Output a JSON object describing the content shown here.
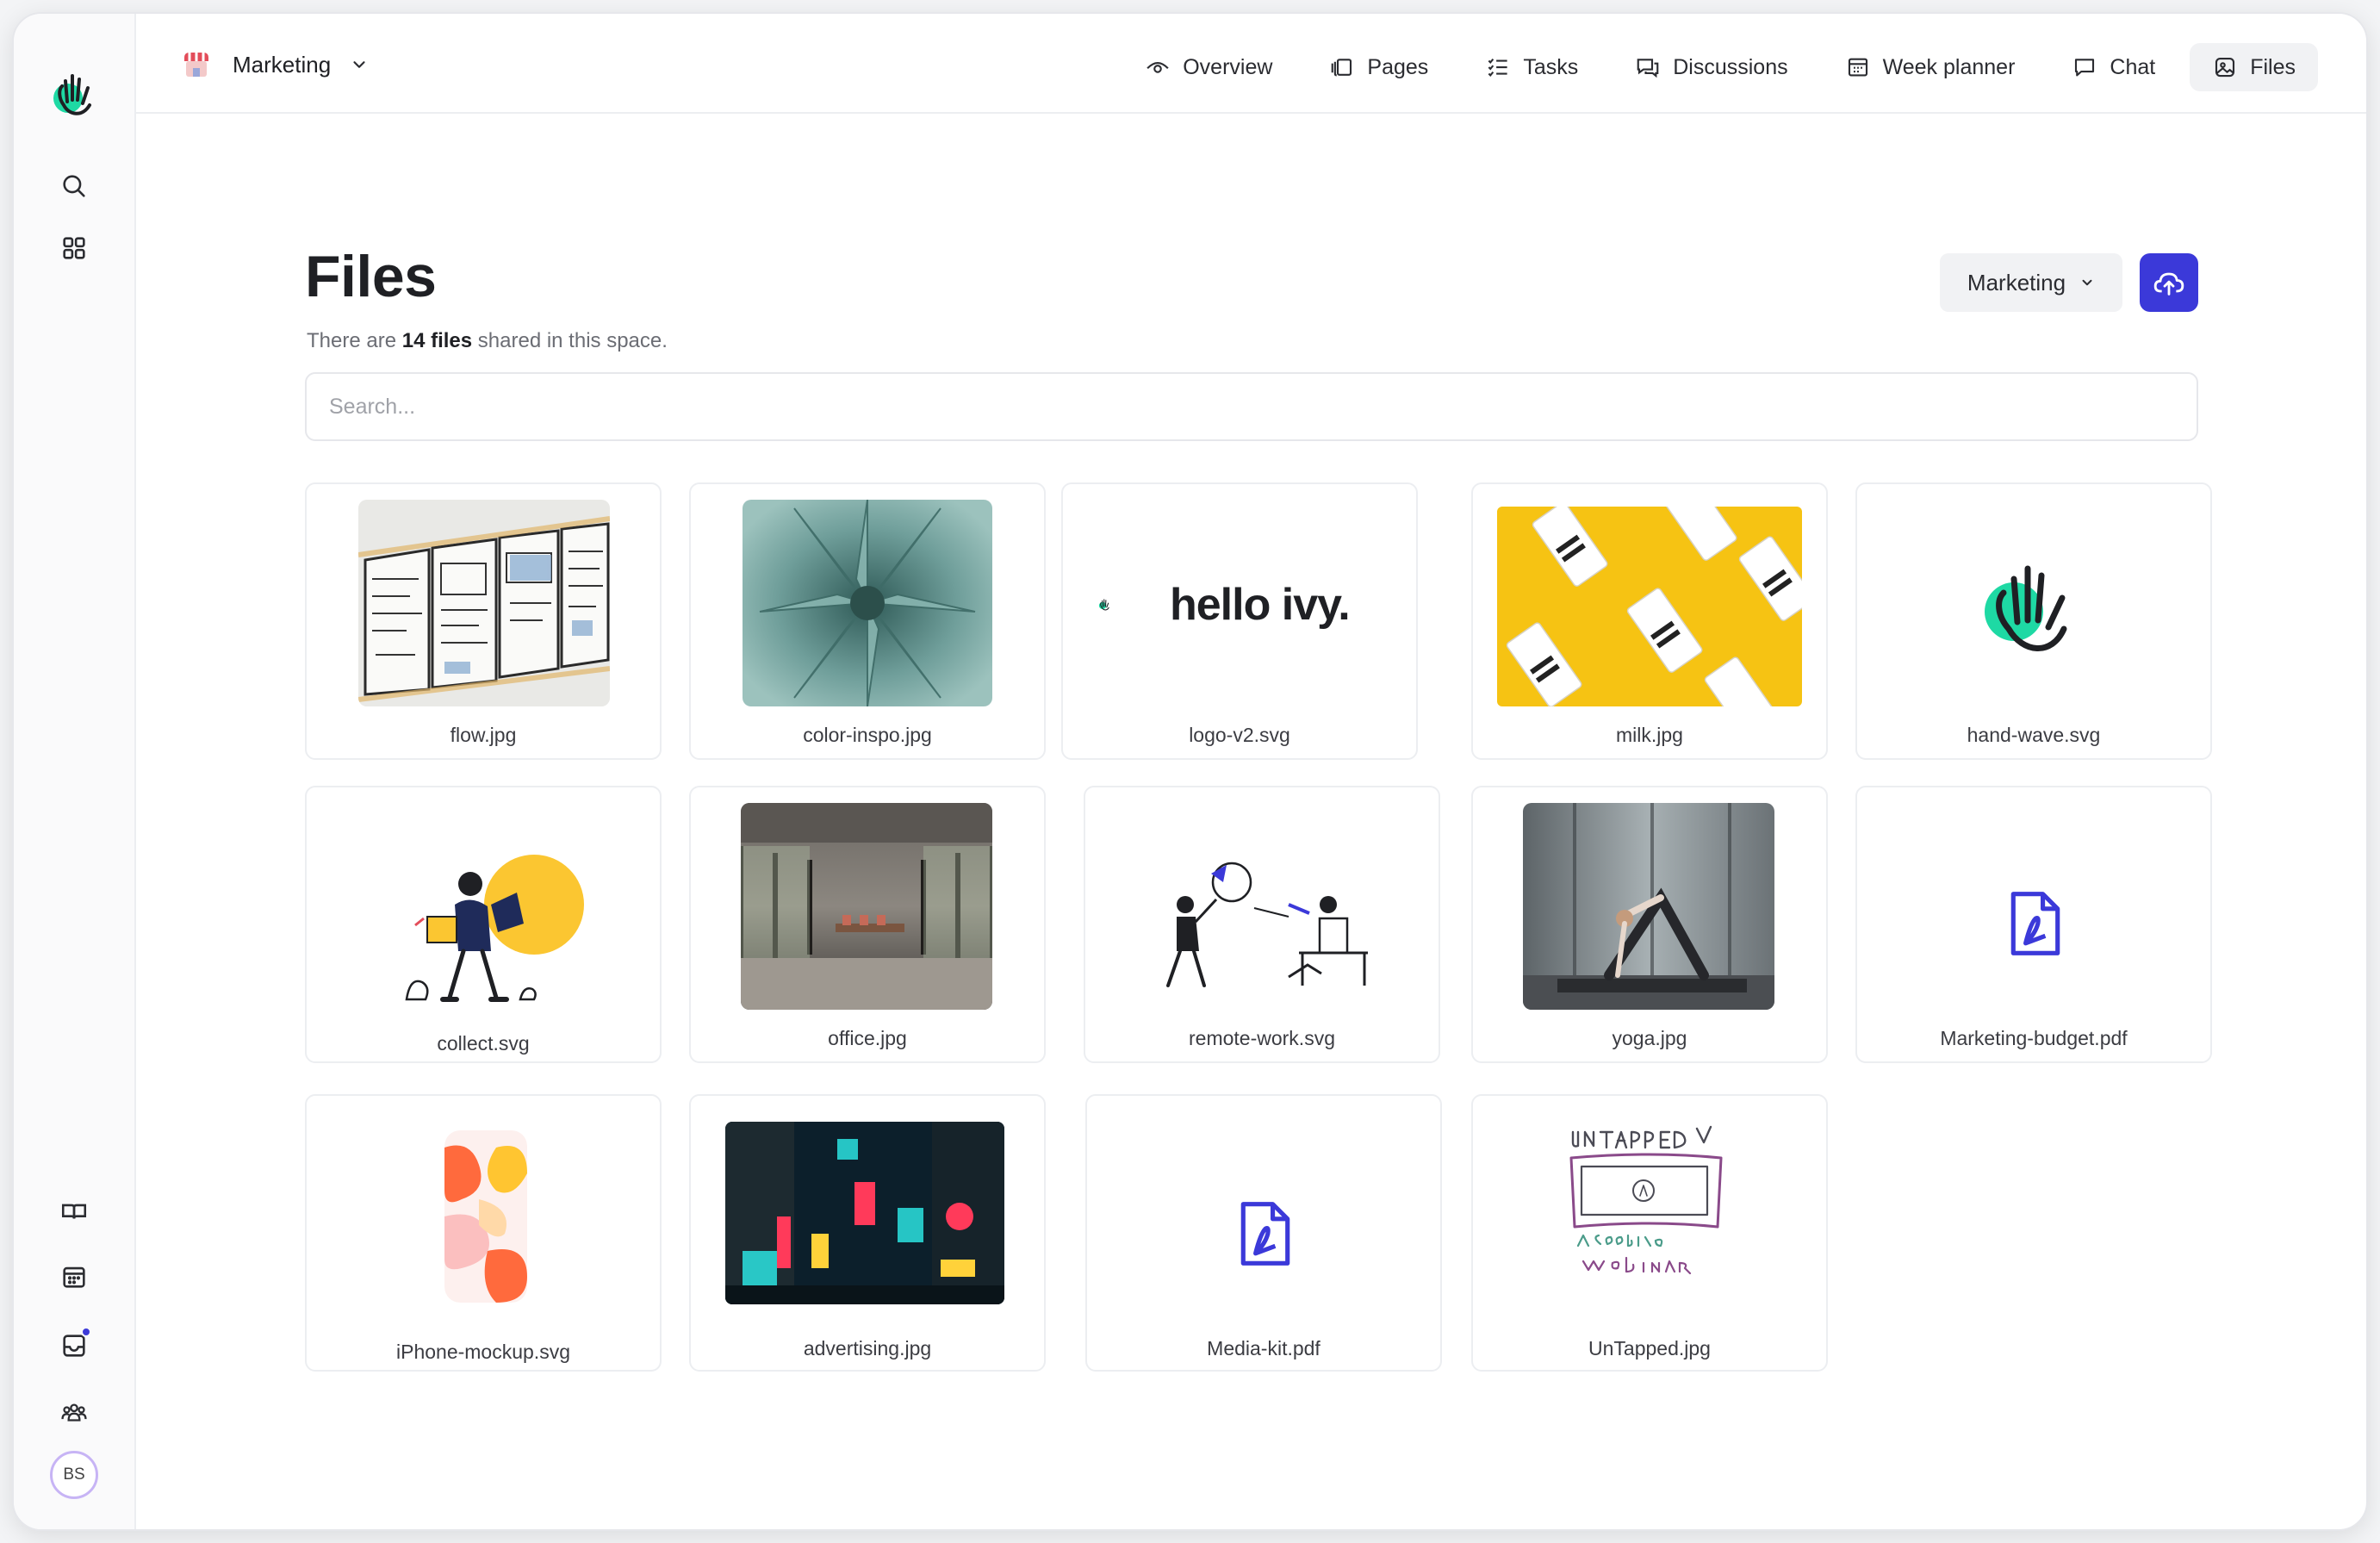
{
  "topbar": {
    "space_name": "Marketing",
    "nav": [
      {
        "label": "Overview",
        "icon": "eye-icon"
      },
      {
        "label": "Pages",
        "icon": "pages-icon"
      },
      {
        "label": "Tasks",
        "icon": "tasks-icon"
      },
      {
        "label": "Discussions",
        "icon": "discussions-icon"
      },
      {
        "label": "Week planner",
        "icon": "calendar-icon"
      },
      {
        "label": "Chat",
        "icon": "chat-icon"
      },
      {
        "label": "Files",
        "icon": "image-icon",
        "active": true
      }
    ]
  },
  "sidebar": {
    "avatar_initials": "BS",
    "icons": [
      "search-icon",
      "grid-icon",
      "book-icon",
      "calendar-icon",
      "inbox-icon",
      "team-icon"
    ]
  },
  "main": {
    "title": "Files",
    "subtitle_pre": "There are ",
    "subtitle_count": "14 files",
    "subtitle_post": " shared in this space.",
    "space_filter": "Marketing",
    "search_placeholder": "Search..."
  },
  "files": [
    {
      "name": "flow.jpg"
    },
    {
      "name": "color-inspo.jpg"
    },
    {
      "name": "logo-v2.svg",
      "logo_text": "hello ivy."
    },
    {
      "name": "milk.jpg"
    },
    {
      "name": "hand-wave.svg"
    },
    {
      "name": "collect.svg"
    },
    {
      "name": "office.jpg"
    },
    {
      "name": "remote-work.svg"
    },
    {
      "name": "yoga.jpg"
    },
    {
      "name": "Marketing-budget.pdf"
    },
    {
      "name": "iPhone-mockup.svg"
    },
    {
      "name": "advertising.jpg"
    },
    {
      "name": "Media-kit.pdf"
    },
    {
      "name": "UnTapped.jpg"
    }
  ],
  "colors": {
    "accent": "#3b39d9",
    "brand_green": "#1ed9a4",
    "border": "#eceef1"
  }
}
